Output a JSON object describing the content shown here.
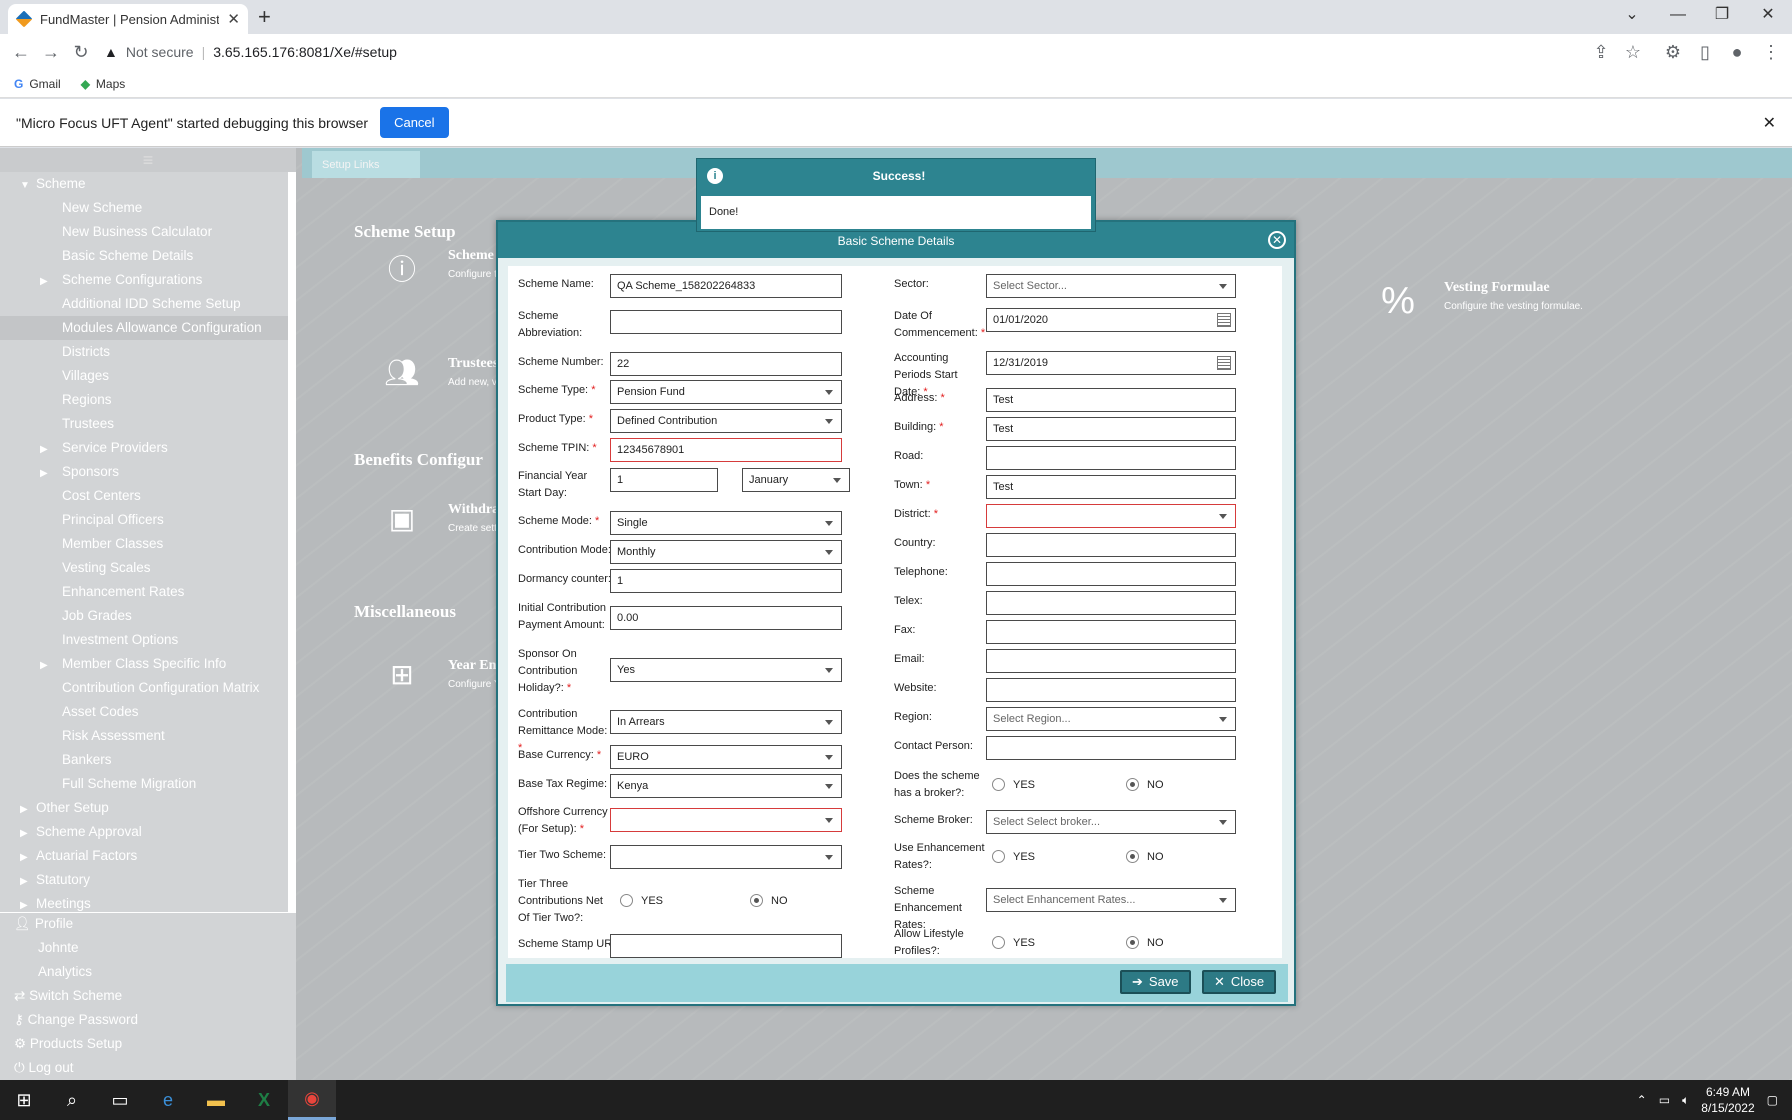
{
  "browser": {
    "tab_title": "FundMaster | Pension Administra",
    "url_prefix": "Not secure",
    "url": "3.65.165.176:8081/Xe/#setup",
    "bookmarks": [
      "Gmail",
      "Maps"
    ],
    "debug_message": "\"Micro Focus UFT Agent\" started debugging this browser",
    "debug_cancel": "Cancel"
  },
  "sidebar": {
    "root": "Scheme",
    "items": [
      {
        "label": "New Scheme",
        "arrow": ""
      },
      {
        "label": "New Business Calculator",
        "arrow": ""
      },
      {
        "label": "Basic Scheme Details",
        "arrow": ""
      },
      {
        "label": "Scheme Configurations",
        "arrow": "▶"
      },
      {
        "label": "Additional IDD Scheme Setup",
        "arrow": ""
      },
      {
        "label": "Modules Allowance Configuration",
        "arrow": ""
      },
      {
        "label": "Districts",
        "arrow": ""
      },
      {
        "label": "Villages",
        "arrow": ""
      },
      {
        "label": "Regions",
        "arrow": ""
      },
      {
        "label": "Trustees",
        "arrow": ""
      },
      {
        "label": "Service Providers",
        "arrow": "▶"
      },
      {
        "label": "Sponsors",
        "arrow": "▶"
      },
      {
        "label": "Cost Centers",
        "arrow": ""
      },
      {
        "label": "Principal Officers",
        "arrow": ""
      },
      {
        "label": "Member Classes",
        "arrow": ""
      },
      {
        "label": "Vesting Scales",
        "arrow": ""
      },
      {
        "label": "Enhancement Rates",
        "arrow": ""
      },
      {
        "label": "Job Grades",
        "arrow": ""
      },
      {
        "label": "Investment Options",
        "arrow": ""
      },
      {
        "label": "Member Class Specific Info",
        "arrow": "▶"
      },
      {
        "label": "Contribution Configuration Matrix",
        "arrow": ""
      },
      {
        "label": "Asset Codes",
        "arrow": ""
      },
      {
        "label": "Risk Assessment",
        "arrow": ""
      },
      {
        "label": "Bankers",
        "arrow": ""
      },
      {
        "label": "Full Scheme Migration",
        "arrow": ""
      }
    ],
    "groups": [
      "Other Setup",
      "Scheme Approval",
      "Actuarial Factors",
      "Statutory",
      "Meetings"
    ],
    "profile": {
      "label": "Profile",
      "user": "Johnte",
      "analytics": "Analytics",
      "links": [
        "Switch Scheme",
        "Change Password",
        "Products Setup",
        "Log out"
      ]
    }
  },
  "main": {
    "tab": "Setup Links",
    "sections": {
      "scheme": "Scheme Setup",
      "benefits": "Benefits Configur",
      "misc": "Miscellaneous"
    },
    "tiles": {
      "scheme_title": "Scheme I",
      "scheme_desc": "Configure t",
      "trustees_title": "Trustees",
      "trustees_desc": "Add new, v",
      "withdrawal_title": "Withdra",
      "withdrawal_desc": "Create sett",
      "year_title": "Year En",
      "year_desc": "Configure Y",
      "vesting_title": "Vesting Formulae",
      "vesting_desc": "Configure the vesting formulae."
    }
  },
  "toast": {
    "title": "Success!",
    "message": "Done!"
  },
  "dialog": {
    "title": "Basic Scheme Details",
    "save": "Save",
    "close": "Close",
    "left": {
      "scheme_name_label": "Scheme Name:",
      "scheme_name": "QA Scheme_158202264833",
      "abbr_label": "Scheme Abbreviation:",
      "abbr": "",
      "number_label": "Scheme Number:",
      "number": "22",
      "type_label": "Scheme Type:",
      "type": "Pension Fund",
      "product_label": "Product Type:",
      "product": "Defined Contribution",
      "tpin_label": "Scheme TPIN:",
      "tpin": "12345678901",
      "fy_label": "Financial Year Start Day:",
      "fy_day": "1",
      "fy_month": "January",
      "mode_label": "Scheme Mode:",
      "mode": "Single",
      "contrib_mode_label": "Contribution Mode:",
      "contrib_mode": "Monthly",
      "dormancy_label": "Dormancy counter:",
      "dormancy": "1",
      "initial_label": "Initial Contribution Payment Amount:",
      "initial": "0.00",
      "holiday_label": "Sponsor On Contribution Holiday?:",
      "holiday": "Yes",
      "remit_label": "Contribution Remittance Mode:",
      "remit": "In Arrears",
      "currency_label": "Base Currency:",
      "currency": "EURO",
      "tax_label": "Base Tax Regime:",
      "tax": "Kenya",
      "offshore_label": "Offshore Currency (For Setup):",
      "offshore": "",
      "tier2_label": "Tier Two Scheme:",
      "tier2": "",
      "tier3_label": "Tier Three Contributions Net Of Tier Two?:",
      "stamp_label": "Scheme Stamp URL:",
      "stamp": ""
    },
    "right": {
      "sector_label": "Sector:",
      "sector": "Select Sector...",
      "doc_label": "Date Of Commencement:",
      "doc": "01/01/2020",
      "acct_label": "Accounting Periods Start Date:",
      "acct": "12/31/2019",
      "address_label": "Address:",
      "address": "Test",
      "building_label": "Building:",
      "building": "Test",
      "road_label": "Road:",
      "road": "",
      "town_label": "Town:",
      "town": "Test",
      "district_label": "District:",
      "district": "",
      "country_label": "Country:",
      "telephone_label": "Telephone:",
      "telex_label": "Telex:",
      "fax_label": "Fax:",
      "email_label": "Email:",
      "website_label": "Website:",
      "region_label": "Region:",
      "region": "Select Region...",
      "contact_label": "Contact Person:",
      "broker_q_label": "Does the scheme has a broker?:",
      "broker_label": "Scheme Broker:",
      "broker": "Select Select broker...",
      "enh_q_label": "Use Enhancement Rates?:",
      "enh_label": "Scheme Enhancement Rates:",
      "enh": "Select Enhancement Rates...",
      "lifestyle_label": "Allow Lifestyle Profiles?:"
    },
    "yes": "YES",
    "no": "NO"
  },
  "taskbar": {
    "time": "6:49 AM",
    "date": "8/15/2022"
  }
}
